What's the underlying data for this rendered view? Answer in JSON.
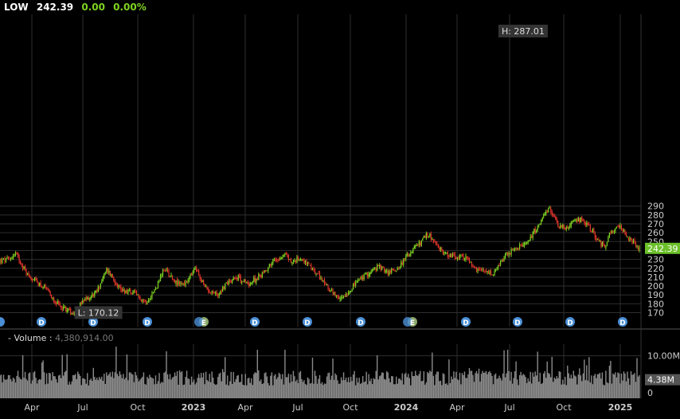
{
  "header": {
    "symbol": "LOW",
    "price": "242.39",
    "change": "0.00",
    "change_pct": "0.00%"
  },
  "colors": {
    "up": "#7ed321",
    "down": "#e0352b",
    "grid": "#2e2e2e",
    "price_badge": "#6cc02a",
    "volume": "#8a8a8a",
    "event_marker": "#4a8fd6",
    "earnings_marker": "#8aa86a"
  },
  "volume_panel": {
    "label": "- Volume :",
    "value": "4,380,914.00",
    "last_badge": "4.38M",
    "axis_labels": [
      "10.00M",
      "0"
    ]
  },
  "chart_data": {
    "type": "candlestick",
    "title": "",
    "x_labels": [
      "Apr",
      "Jul",
      "Oct",
      "2023",
      "Apr",
      "Jul",
      "Oct",
      "2024",
      "Apr",
      "Jul",
      "Oct",
      "2025"
    ],
    "y_ticks": [
      170,
      180,
      190,
      200,
      210,
      220,
      230,
      240,
      250,
      260,
      270,
      280,
      290
    ],
    "ylim": [
      165,
      292
    ],
    "high_label": "H: 287.01",
    "low_label": "L: 170.12",
    "last_price_badge": "242.39",
    "event_markers": [
      "",
      "D",
      "D",
      "D",
      "E",
      "D",
      "D",
      "D",
      "E",
      "D",
      "D",
      "D",
      "D"
    ],
    "close_path": [
      [
        0,
        228
      ],
      [
        0.03,
        230
      ],
      [
        0.05,
        237
      ],
      [
        0.09,
        212
      ],
      [
        0.14,
        199
      ],
      [
        0.19,
        178
      ],
      [
        0.235,
        170.12
      ],
      [
        0.27,
        183
      ],
      [
        0.31,
        193
      ],
      [
        0.345,
        219
      ],
      [
        0.39,
        196
      ],
      [
        0.43,
        192
      ],
      [
        0.47,
        182
      ],
      [
        0.5,
        196
      ],
      [
        0.53,
        220
      ],
      [
        0.57,
        203
      ],
      [
        0.6,
        203
      ],
      [
        0.63,
        220
      ],
      [
        0.66,
        198
      ],
      [
        0.7,
        190
      ],
      [
        0.73,
        203
      ],
      [
        0.76,
        211
      ],
      [
        0.8,
        202
      ],
      [
        0.84,
        212
      ],
      [
        0.88,
        228
      ],
      [
        0.92,
        236
      ],
      [
        0.94,
        226
      ],
      [
        0.97,
        232
      ],
      [
        1.0,
        220
      ],
      [
        1.03,
        210
      ],
      [
        1.06,
        197
      ],
      [
        1.09,
        184
      ],
      [
        1.12,
        193
      ],
      [
        1.15,
        205
      ],
      [
        1.19,
        215
      ],
      [
        1.22,
        222
      ],
      [
        1.25,
        215
      ],
      [
        1.28,
        220
      ],
      [
        1.32,
        237
      ],
      [
        1.35,
        247
      ],
      [
        1.38,
        259
      ],
      [
        1.41,
        243
      ],
      [
        1.44,
        236
      ],
      [
        1.47,
        232
      ],
      [
        1.5,
        233
      ],
      [
        1.53,
        218
      ],
      [
        1.56,
        216
      ],
      [
        1.59,
        213
      ],
      [
        1.63,
        235
      ],
      [
        1.66,
        242
      ],
      [
        1.69,
        246
      ],
      [
        1.72,
        261
      ],
      [
        1.75,
        276
      ],
      [
        1.77,
        287.01
      ],
      [
        1.8,
        268
      ],
      [
        1.83,
        266
      ],
      [
        1.86,
        275
      ],
      [
        1.88,
        274
      ],
      [
        1.91,
        261
      ],
      [
        1.93,
        248
      ],
      [
        1.95,
        246
      ],
      [
        1.97,
        262
      ],
      [
        2.0,
        266
      ],
      [
        2.03,
        252
      ],
      [
        2.06,
        242.39
      ]
    ],
    "volume_ylim": [
      0,
      12
    ],
    "volume_unit": "M"
  }
}
